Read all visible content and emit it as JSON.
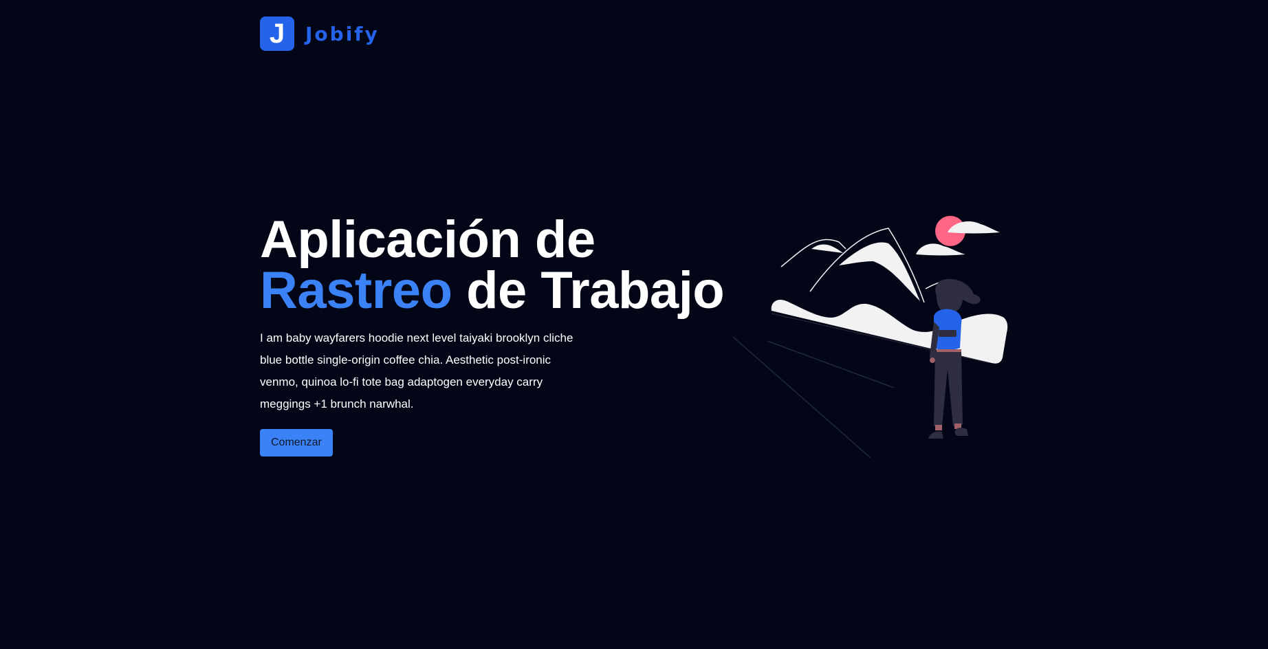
{
  "brand": {
    "logo_letter": "J",
    "name": "Jobify"
  },
  "hero": {
    "title_line1": "Aplicación de",
    "title_accent": "Rastreo",
    "title_rest": " de Trabajo",
    "description": "I am baby wayfarers hoodie next level taiyaki brooklyn cliche blue bottle single-origin coffee chia. Aesthetic post-ironic venmo, quinoa lo-fi tote bag adaptogen everyday carry meggings +1 brunch narwhal.",
    "cta_label": "Comenzar"
  },
  "colors": {
    "background": "#020617",
    "primary": "#2563eb",
    "accent": "#3b82f6",
    "sun": "#ff6584"
  },
  "illustration": {
    "icon": "woman-mountains-illustration"
  }
}
